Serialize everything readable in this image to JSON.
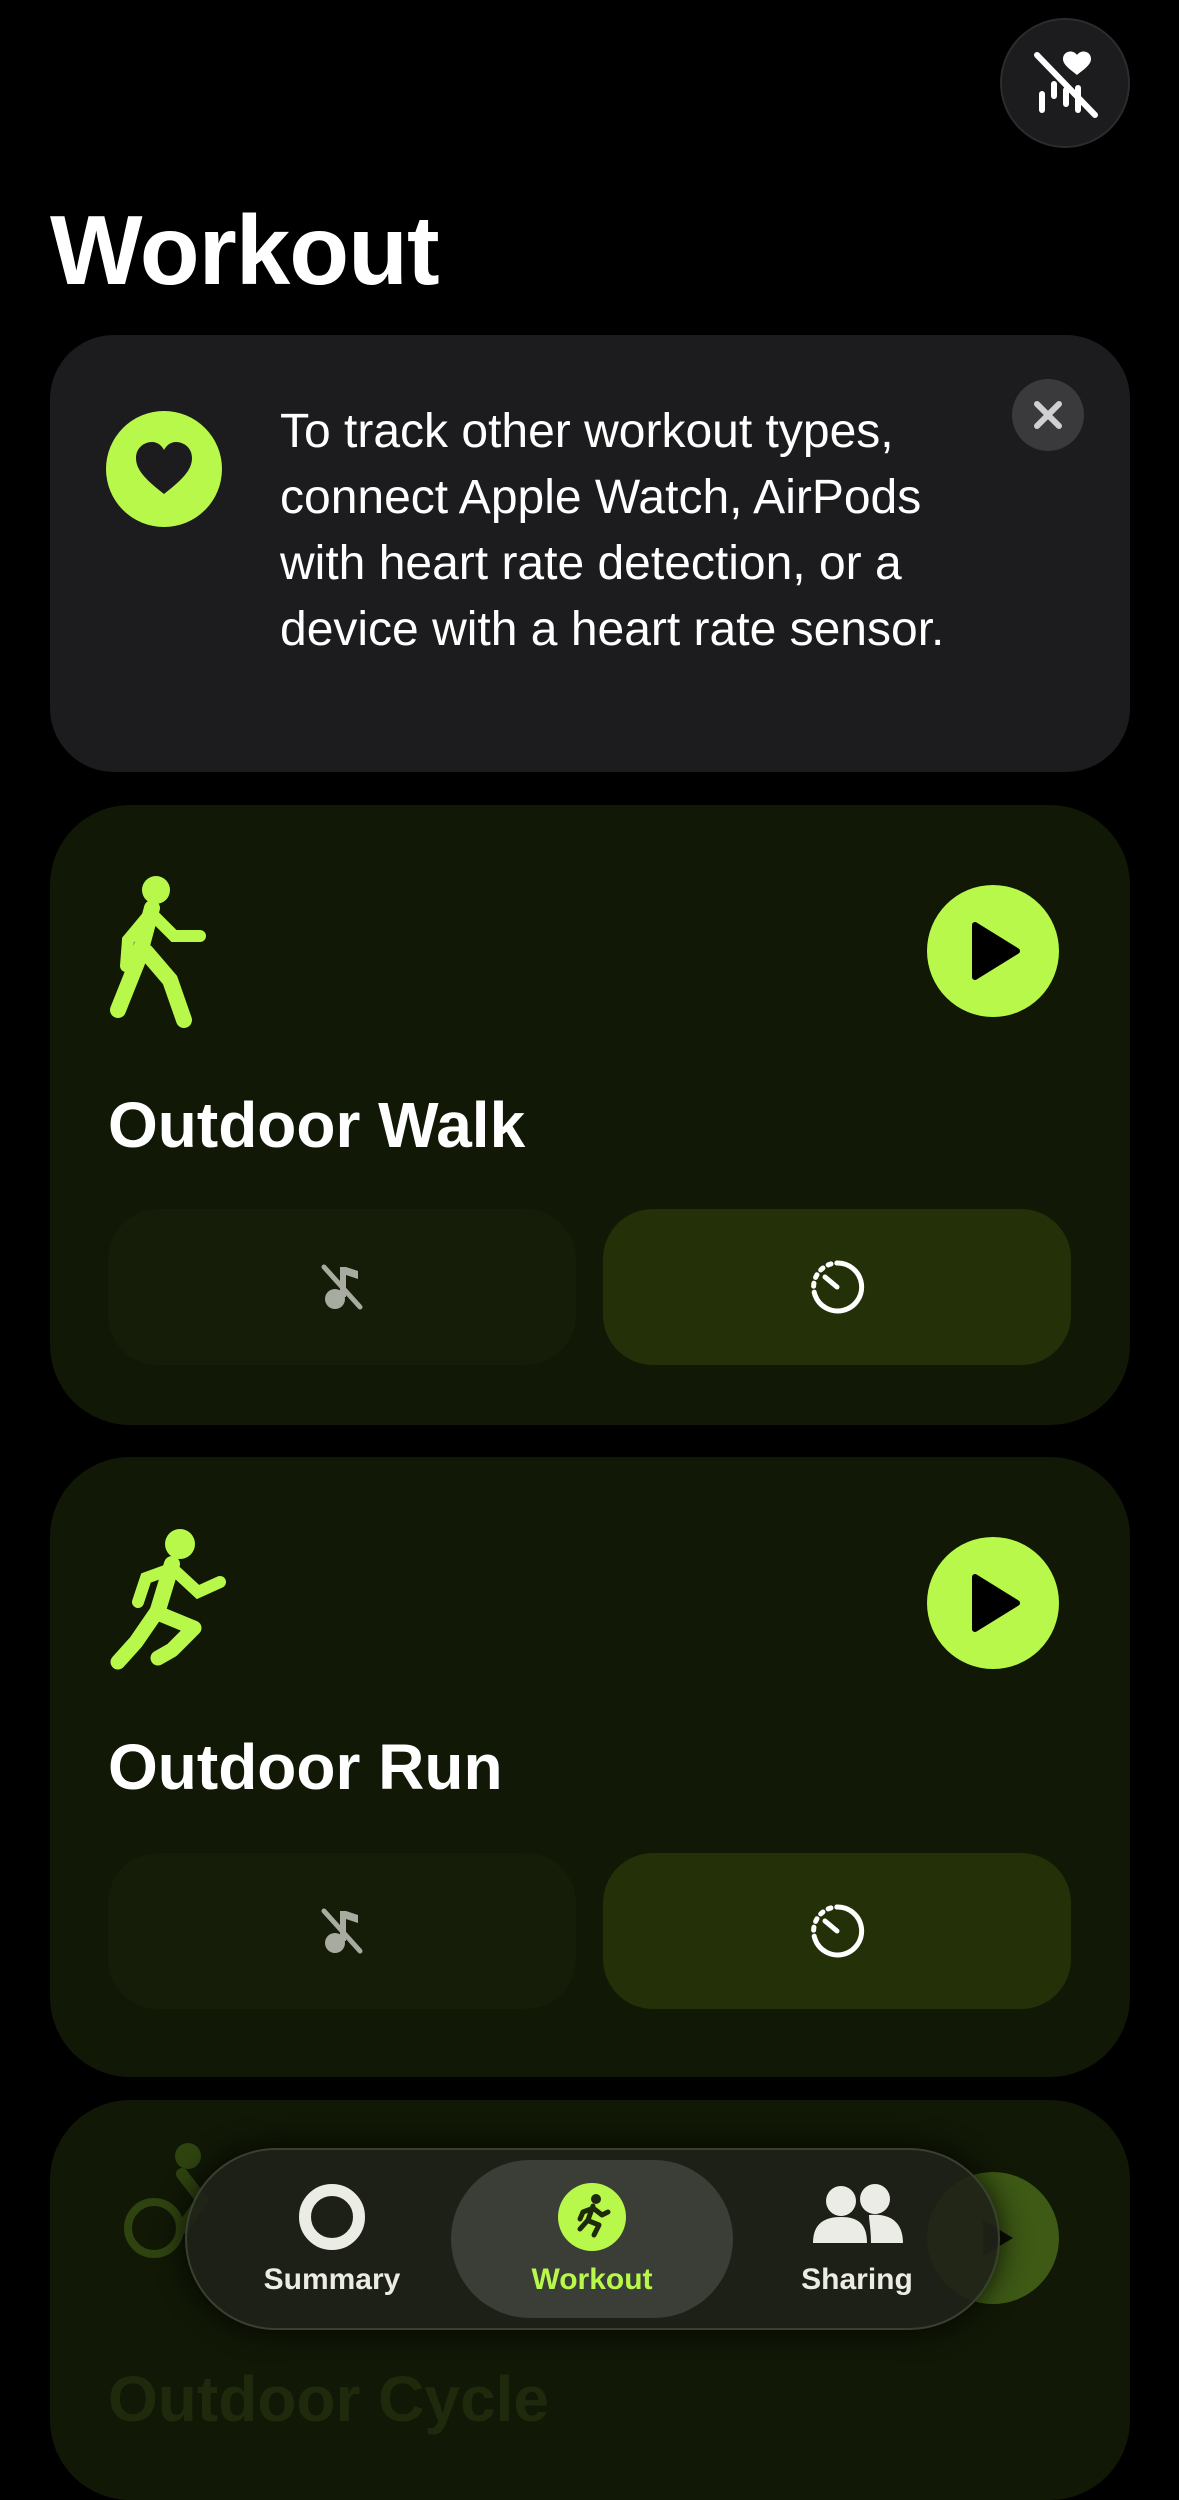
{
  "colors": {
    "accent": "#b8f84b",
    "background": "#000000",
    "card": "#111806"
  },
  "header": {
    "title": "Workout",
    "heart_rate_status_icon": "heart-slash-icon"
  },
  "banner": {
    "icon": "heart-icon",
    "text": "To track other workout types, connect Apple Watch, AirPods with heart rate detection, or a device with a heart rate sensor.",
    "close_icon": "close-icon"
  },
  "workouts": [
    {
      "title": "Outdoor Walk",
      "icon": "walking-figure-icon",
      "start_icon": "play-icon",
      "music_icon": "music-off-icon",
      "goal_icon": "timer-icon"
    },
    {
      "title": "Outdoor Run",
      "icon": "running-figure-icon",
      "start_icon": "play-icon",
      "music_icon": "music-off-icon",
      "goal_icon": "timer-icon"
    },
    {
      "title": "Outdoor Cycle",
      "icon": "cycling-figure-icon",
      "start_icon": "play-icon"
    }
  ],
  "tabs": [
    {
      "label": "Summary",
      "icon": "activity-ring-icon",
      "active": false
    },
    {
      "label": "Workout",
      "icon": "running-figure-icon",
      "active": true
    },
    {
      "label": "Sharing",
      "icon": "people-icon",
      "active": false
    }
  ]
}
